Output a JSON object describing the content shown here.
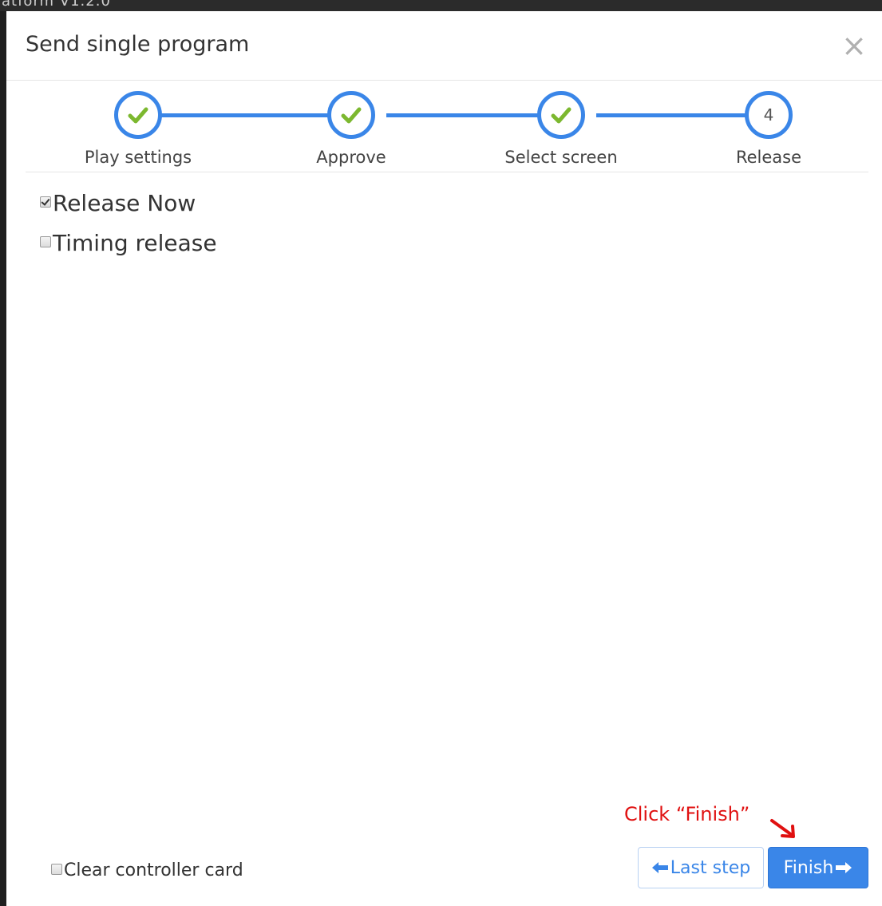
{
  "window": {
    "behind_title": "atform V1.2.0"
  },
  "modal": {
    "title": "Send single program",
    "close_symbol": "×"
  },
  "steps": [
    {
      "label": "Play settings",
      "state": "done",
      "icon": "check-icon"
    },
    {
      "label": "Approve",
      "state": "done",
      "icon": "check-icon"
    },
    {
      "label": "Select screen",
      "state": "done",
      "icon": "check-icon"
    },
    {
      "label": "Release",
      "state": "current",
      "number": "4"
    }
  ],
  "options": {
    "release_now": {
      "label": "Release Now",
      "checked": true
    },
    "timing_release": {
      "label": "Timing release",
      "checked": false
    }
  },
  "footer": {
    "clear_card": {
      "label": "Clear controller card",
      "checked": false
    },
    "last_step_label": "Last step",
    "finish_label": "Finish"
  },
  "annotation": {
    "text": "Click “Finish”"
  },
  "colors": {
    "accent": "#3a86e8",
    "check": "#7cb82f",
    "annotation": "#e01010"
  }
}
